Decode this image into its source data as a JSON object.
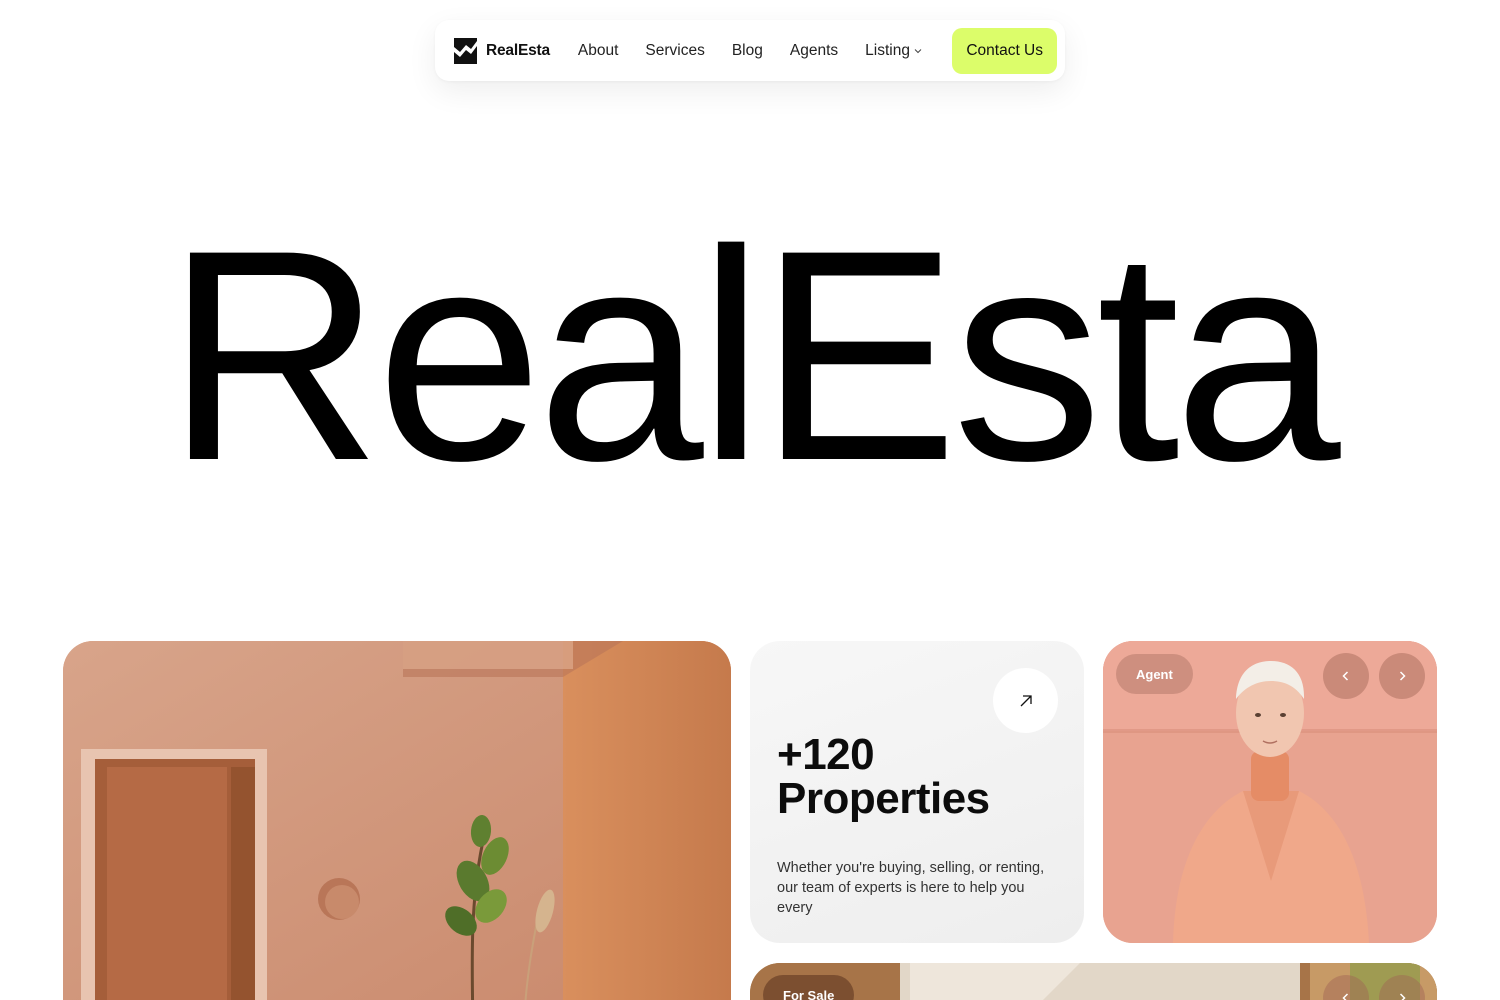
{
  "nav": {
    "brand": "RealEsta",
    "links": [
      {
        "label": "About"
      },
      {
        "label": "Services"
      },
      {
        "label": "Blog"
      },
      {
        "label": "Agents"
      },
      {
        "label": "Listing"
      }
    ],
    "contact_label": "Contact Us",
    "accent_color": "#dcfd6a"
  },
  "hero": {
    "title": "RealEsta"
  },
  "stats_card": {
    "count": "+120",
    "label": "Properties",
    "description": "Whether you're buying, selling, or renting, our team of experts is here to help you every",
    "icon": "arrow-up-right-icon"
  },
  "agent_card": {
    "badge": "Agent",
    "prev_icon": "chevron-left-icon",
    "next_icon": "chevron-right-icon"
  },
  "sale_card": {
    "badge": "For Sale"
  }
}
